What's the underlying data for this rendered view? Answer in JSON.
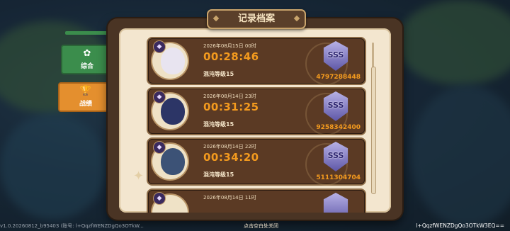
{
  "window": {
    "title": "记录档案"
  },
  "tabs": [
    {
      "label": "综合",
      "icon": "lotus-icon"
    },
    {
      "label": "战绩",
      "icon": "trophy-icon"
    }
  ],
  "records": [
    {
      "date": "2026年08月15日 00时",
      "time": "00:28:46",
      "level": "混沌等级15",
      "grade": "SSS",
      "score": "4797288448",
      "face_color": "#e8e4f0"
    },
    {
      "date": "2026年08月14日 23时",
      "time": "00:31:25",
      "level": "混沌等级15",
      "grade": "SSS",
      "score": "9258342400",
      "face_color": "#2c3566"
    },
    {
      "date": "2026年08月14日 22时",
      "time": "00:34:20",
      "level": "混沌等级15",
      "grade": "SSS",
      "score": "5111304704",
      "face_color": "#3c5276"
    },
    {
      "date": "2026年08月14日 11时",
      "time": "",
      "level": "",
      "grade": "SSS",
      "score": "",
      "face_color": "#cfc6e0"
    }
  ],
  "footer": {
    "version": "v1.0.20260812_b95403 (账号: l+QqzfWENZDgQo3OTkW...",
    "hint": "点击空白处关闭",
    "account": "l+QqzfWENZDgQo3OTkW3EQ=="
  },
  "colors": {
    "accent": "#f39a1e",
    "panel": "#4a3424",
    "paper": "#f3e6cf"
  }
}
